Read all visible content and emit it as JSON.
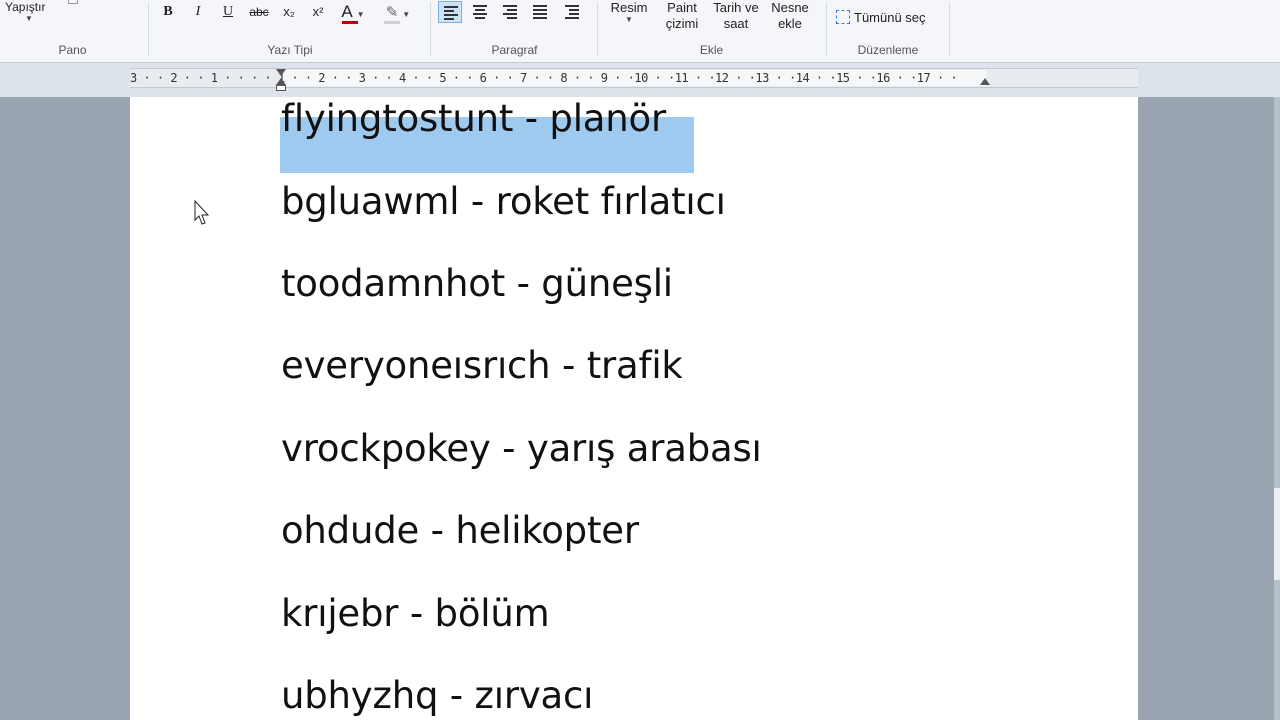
{
  "ribbon": {
    "pano": {
      "label": "Pano",
      "paste_label": "Yapıştır"
    },
    "font": {
      "label": "Yazı Tipi",
      "bold": "B",
      "italic": "I",
      "underline": "U",
      "strikethrough": "abc",
      "subscript": "x₂",
      "superscript": "x²",
      "font_color": "A",
      "font_color_hex": "#c00000"
    },
    "paragraph": {
      "label": "Paragraf"
    },
    "insert": {
      "label": "Ekle",
      "resim": "Resim",
      "paint_line1": "Paint",
      "paint_line2": "çizimi",
      "datetime_line1": "Tarih ve",
      "datetime_line2": "saat",
      "object_line1": "Nesne",
      "object_line2": "ekle"
    },
    "editing": {
      "label": "Düzenleme",
      "select_all": "Tümünü seç"
    }
  },
  "ruler": {
    "text": "3 · · 2 · · 1 · · · · 1 · · 2 · · 3 · · 4 · · 5 · · 6 · · 7 · · 8 · · 9 · ·10 · ·11 · ·12 · ·13 · ·14 · ·15 · ·16 · ·17 · ·"
  },
  "document": {
    "lines": [
      "flyingtostunt  - planör",
      "bgluawml  - roket fırlatıcı",
      "toodamnhot - güneşli",
      "everyoneısrıch  - trafik",
      "vrockpokey - yarış arabası",
      "ohdude - helikopter",
      "krıjebr - bölüm",
      "ubhyzhq - zırvacı"
    ],
    "selected_line_index": 0,
    "selection_color": "#9fcaf0"
  }
}
